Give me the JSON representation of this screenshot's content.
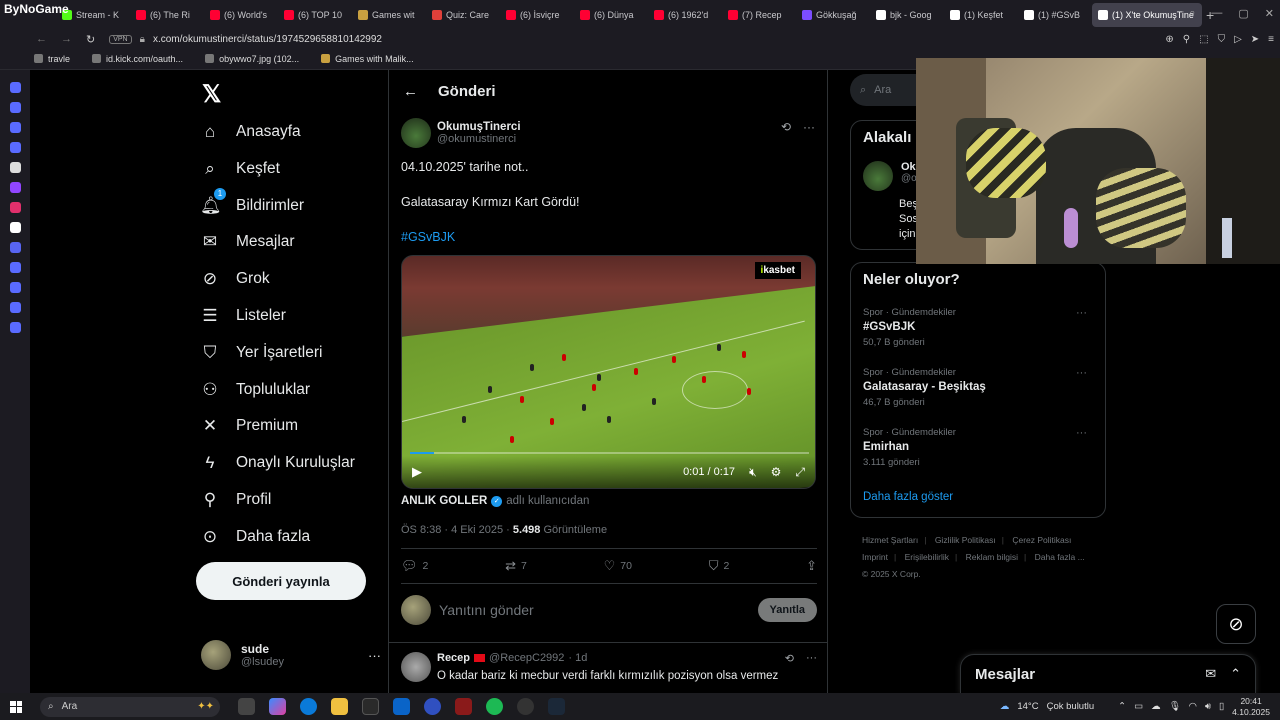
{
  "browser": {
    "brand": "ByNoGame",
    "tabs": [
      {
        "label": "Stream - K",
        "color": "#53fc18"
      },
      {
        "label": "(6) The Ri",
        "color": "#ff0033"
      },
      {
        "label": "(6) World's",
        "color": "#ff0033"
      },
      {
        "label": "(6) TOP 10",
        "color": "#ff0033"
      },
      {
        "label": "Games wit",
        "color": "#c8a040"
      },
      {
        "label": "Quiz: Care",
        "color": "#e0403a"
      },
      {
        "label": "(6) İsviçre",
        "color": "#ff0033"
      },
      {
        "label": "(6) Dünya",
        "color": "#ff0033"
      },
      {
        "label": "(6) 1962'd",
        "color": "#ff0033"
      },
      {
        "label": "(7) Recep",
        "color": "#ff0033"
      },
      {
        "label": "Gökkuşağ",
        "color": "#7b4dff"
      },
      {
        "label": "bjk - Goog",
        "color": "#ffffff"
      },
      {
        "label": "(1) Keşfet",
        "color": "#ffffff"
      },
      {
        "label": "(1) #GSvB",
        "color": "#ffffff"
      },
      {
        "label": "(1) X'te OkumuşTine",
        "color": "#ffffff",
        "active": true
      }
    ],
    "vpn": "VPN",
    "url": "x.com/okumustinerci/status/1974529658810142992",
    "bookmarks": [
      "travle",
      "id.kick.com/oauth...",
      "obywwo7.jpg (102...",
      "Games with Malik..."
    ]
  },
  "nav": {
    "items": [
      {
        "label": "Anasayfa",
        "icon": "home-icon"
      },
      {
        "label": "Keşfet",
        "icon": "search-icon"
      },
      {
        "label": "Bildirimler",
        "icon": "bell-icon"
      },
      {
        "label": "Mesajlar",
        "icon": "mail-icon"
      },
      {
        "label": "Grok",
        "icon": "grok-icon"
      },
      {
        "label": "Listeler",
        "icon": "list-icon"
      },
      {
        "label": "Yer İşaretleri",
        "icon": "bookmark-icon"
      },
      {
        "label": "Topluluklar",
        "icon": "people-icon"
      },
      {
        "label": "Premium",
        "icon": "x-icon"
      },
      {
        "label": "Onaylı Kuruluşlar",
        "icon": "lightning-icon"
      },
      {
        "label": "Profil",
        "icon": "person-icon"
      },
      {
        "label": "Daha fazla",
        "icon": "more-circle-icon"
      }
    ],
    "notif_count": "1",
    "post_button": "Gönderi yayınla",
    "account_name": "sude",
    "account_handle": "@lsudey"
  },
  "post": {
    "header_title": "Gönderi",
    "author_name": "OkumuşTinerci",
    "author_handle": "@okumustinerci",
    "line1": "04.10.2025' tarihe not..",
    "line2": "Galatasaray Kırmızı Kart Gördü!",
    "hashtag": "#GSvBJK",
    "sponsor_prefix": "i",
    "sponsor_text": "kasbet",
    "video_time": "0:01 / 0:17",
    "video_progress": 0.06,
    "credit_name": "ANLIK GOLLER",
    "credit_sub": "adlı kullanıcıdan",
    "time": "ÖS 8:38 · 4 Eki 2025 · ",
    "views": "5.498",
    "views_label": " Görüntüleme",
    "replies": "2",
    "reposts": "7",
    "likes": "70",
    "bookmarks": "2",
    "reply_placeholder": "Yanıtını gönder",
    "reply_button": "Yanıtla"
  },
  "reply": {
    "name": "Recep",
    "handle": "@RecepC2992",
    "time": "· 1d",
    "text": "O kadar bariz ki mecbur verdi farklı kırmızılık pozisyon olsa vermez"
  },
  "right": {
    "search_placeholder": "Ara",
    "related_title": "Alakalı",
    "related_name": "Oku",
    "related_handle": "@o",
    "related_bio1": "Beş",
    "related_bio2": "Sos",
    "related_bio3": "için",
    "trends_title": "Neler oluyor?",
    "trends": [
      {
        "cat": "Spor · Gündemdekiler",
        "name": "#GSvBJK",
        "count": "50,7 B gönderi"
      },
      {
        "cat": "Spor · Gündemdekiler",
        "name": "Galatasaray - Beşiktaş",
        "count": "46,7 B gönderi"
      },
      {
        "cat": "Spor · Gündemdekiler",
        "name": "Emirhan",
        "count": "3.111 gönderi"
      }
    ],
    "show_more": "Daha fazla göster",
    "footer": [
      "Hizmet Şartları",
      "Gizlilik Politikası",
      "Çerez Politikası",
      "Imprint",
      "Erişilebilirlik",
      "Reklam bilgisi",
      "Daha fazla ...",
      "© 2025 X Corp."
    ]
  },
  "messages_drawer": {
    "title": "Mesajlar"
  },
  "taskbar": {
    "search": "Ara",
    "weather": "14°C",
    "weather_desc": "Çok bulutlu",
    "time": "20:41",
    "date": "4.10.2025"
  }
}
